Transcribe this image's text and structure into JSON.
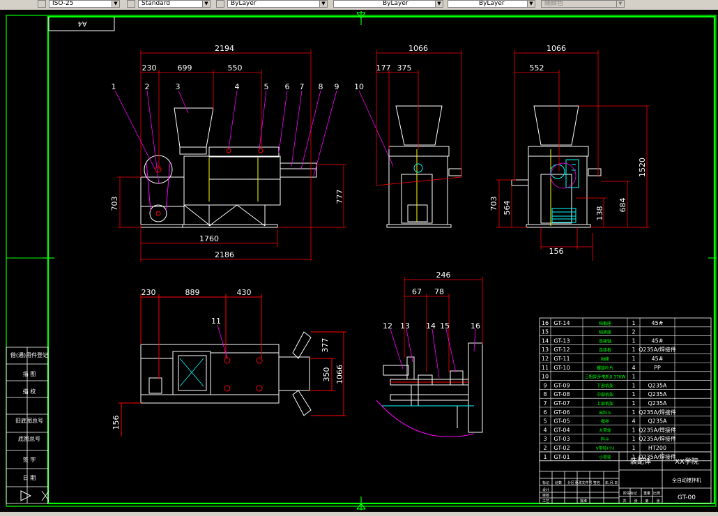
{
  "toolbar": {
    "dimstyle": "ISO-25",
    "textstyle": "Standard",
    "layer": "ByLayer",
    "linetype": "ByLayer",
    "lineweight": "ByLayer",
    "plotstyle": "随颜色"
  },
  "sheet": {
    "size": "A4"
  },
  "dims": {
    "front": [
      "2194",
      "230",
      "699",
      "550",
      "1760",
      "2186",
      "703",
      "777"
    ],
    "side1": [
      "1066",
      "177",
      "375"
    ],
    "side2": [
      "1066",
      "552",
      "1520",
      "703",
      "564",
      "138",
      "684",
      "156"
    ],
    "plan": [
      "230",
      "889",
      "430",
      "377",
      "350",
      "1066",
      "156"
    ],
    "detail": [
      "246",
      "67",
      "78"
    ]
  },
  "balloons": [
    "1",
    "2",
    "3",
    "4",
    "5",
    "6",
    "7",
    "8",
    "9",
    "10",
    "11",
    "12",
    "13",
    "14",
    "15",
    "16"
  ],
  "bom": [
    [
      "16",
      "GT-14",
      "挡板座",
      "1",
      "45#"
    ],
    [
      "15",
      "",
      "轴承座",
      "2",
      ""
    ],
    [
      "14",
      "GT-13",
      "连接轴",
      "1",
      "45#"
    ],
    [
      "13",
      "GT-12",
      "连接板",
      "1",
      "Q235A/焊接件"
    ],
    [
      "12",
      "GT-11",
      "轴座",
      "1",
      "45#"
    ],
    [
      "11",
      "GT-10",
      "螺旋叶片",
      "4",
      "PP"
    ],
    [
      "10",
      "",
      "三相异步电机0.37KW",
      "1",
      ""
    ],
    [
      "9",
      "GT-09",
      "下部机架",
      "1",
      "Q235A"
    ],
    [
      "8",
      "GT-08",
      "中部机架",
      "1",
      "Q235A"
    ],
    [
      "7",
      "GT-07",
      "上部机架",
      "1",
      "Q235A"
    ],
    [
      "6",
      "GT-06",
      "出料斗",
      "1",
      "Q235A/焊接件"
    ],
    [
      "5",
      "GT-05",
      "搅拌",
      "4",
      "Q235A"
    ],
    [
      "4",
      "GT-04",
      "大带轮",
      "1",
      "Q235A/焊接件"
    ],
    [
      "3",
      "GT-03",
      "料斗",
      "1",
      "Q235A/焊接件"
    ],
    [
      "2",
      "GT-02",
      "V带轮(小)",
      "1",
      "HT200"
    ],
    [
      "1",
      "GT-01",
      "小带轮",
      "1",
      "Q235A/焊接件"
    ]
  ],
  "leftstrip": [
    "借(通)用件登记",
    "描 图",
    "描 校",
    "旧底图总号",
    "底图总号",
    "签 字",
    "日 期"
  ],
  "titleblock": {
    "company": "XX学院",
    "drawing_name": "装配体",
    "product": "全自动搅拌机",
    "drawing_no": "GT-00",
    "labels": [
      "标记",
      "处数",
      "分区",
      "更改文件号",
      "签名",
      "年.月.日",
      "设计",
      "审核",
      "工艺",
      "批准",
      "阶段标记",
      "重量",
      "比例",
      "共",
      "张",
      "第",
      "张"
    ]
  }
}
